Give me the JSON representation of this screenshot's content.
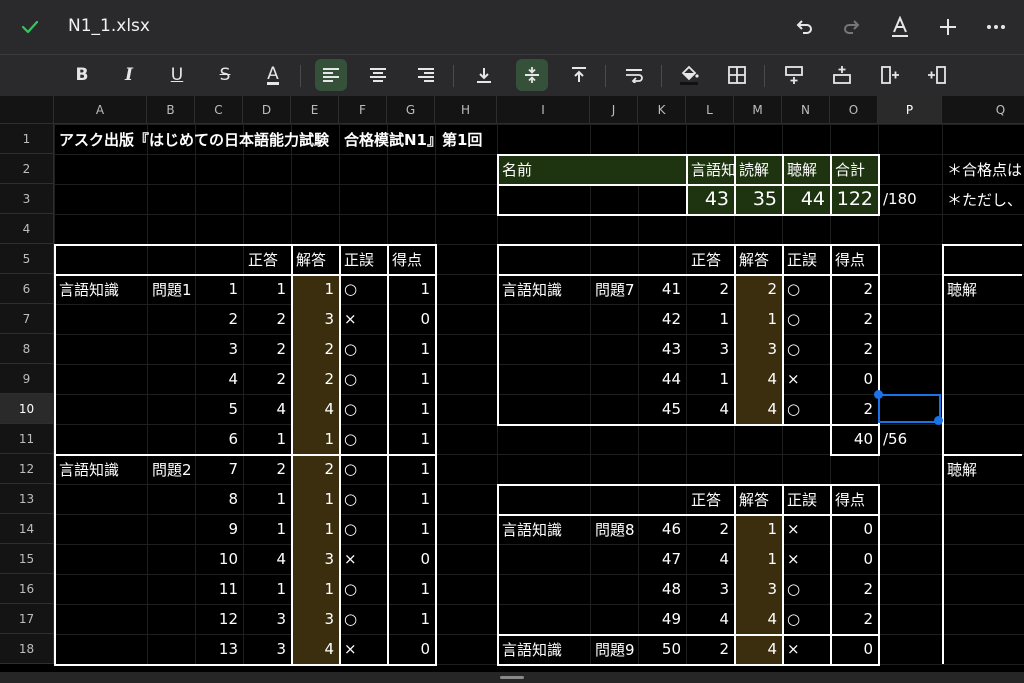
{
  "app": {
    "filename": "N1_1.xlsx",
    "icons": {
      "done": "checkmark-icon",
      "undo": "undo-icon",
      "redo": "redo-icon",
      "format": "text-format-icon",
      "add": "plus-icon",
      "more": "ellipsis-icon"
    }
  },
  "toolbar": {
    "buttons": [
      {
        "name": "bold-button",
        "glyph": "B"
      },
      {
        "name": "italic-button",
        "glyph": "I"
      },
      {
        "name": "underline-button",
        "glyph": "U"
      },
      {
        "name": "strikethrough-button",
        "glyph": "S"
      },
      {
        "name": "text-color-button",
        "glyph": "A"
      },
      {
        "name": "align-left-button",
        "glyph": "≡"
      },
      {
        "name": "align-center-button",
        "glyph": "≡"
      },
      {
        "name": "align-right-button",
        "glyph": "≡"
      },
      {
        "name": "valign-bottom-button",
        "glyph": "⤓"
      },
      {
        "name": "valign-middle-button",
        "glyph": "÷"
      },
      {
        "name": "valign-top-button",
        "glyph": "⤒"
      },
      {
        "name": "wrap-text-button",
        "glyph": "⇌"
      },
      {
        "name": "fill-color-button",
        "glyph": "◆"
      },
      {
        "name": "borders-button",
        "glyph": "⊞"
      },
      {
        "name": "insert-row-above-button",
        "glyph": "⊤"
      },
      {
        "name": "insert-row-below-button",
        "glyph": "⊥"
      },
      {
        "name": "insert-column-right-button",
        "glyph": "⊢"
      },
      {
        "name": "insert-column-left-button",
        "glyph": "⊣"
      }
    ]
  },
  "sheet": {
    "columns": [
      "A",
      "B",
      "C",
      "D",
      "E",
      "F",
      "G",
      "H",
      "I",
      "J",
      "K",
      "L",
      "M",
      "N",
      "O",
      "P",
      "Q"
    ],
    "rows": [
      "1",
      "2",
      "3",
      "4",
      "5",
      "6",
      "7",
      "8",
      "9",
      "10",
      "11",
      "12",
      "13",
      "14",
      "15",
      "16",
      "17",
      "18"
    ],
    "selected_column": "P",
    "selected_row": "10",
    "title": "アスク出版『はじめての日本語能力試験　合格模試N1』第1回",
    "summary": {
      "name_label": "名前",
      "headers": [
        "言語知識",
        "読解",
        "聴解",
        "合計"
      ],
      "values": [
        "43",
        "35",
        "44",
        "122"
      ],
      "max_total": "/180"
    },
    "notes": [
      "＊合格点は",
      "＊ただし、"
    ],
    "table_headers": [
      "正答",
      "解答",
      "正誤",
      "得点"
    ],
    "left_table": {
      "rows": [
        {
          "section": "言語知識",
          "problem": "問題1",
          "no": "1",
          "correct": "1",
          "answer": "1",
          "result": "○",
          "score": "1"
        },
        {
          "section": "",
          "problem": "",
          "no": "2",
          "correct": "2",
          "answer": "3",
          "result": "×",
          "score": "0"
        },
        {
          "section": "",
          "problem": "",
          "no": "3",
          "correct": "2",
          "answer": "2",
          "result": "○",
          "score": "1"
        },
        {
          "section": "",
          "problem": "",
          "no": "4",
          "correct": "2",
          "answer": "2",
          "result": "○",
          "score": "1"
        },
        {
          "section": "",
          "problem": "",
          "no": "5",
          "correct": "4",
          "answer": "4",
          "result": "○",
          "score": "1"
        },
        {
          "section": "",
          "problem": "",
          "no": "6",
          "correct": "1",
          "answer": "1",
          "result": "○",
          "score": "1"
        },
        {
          "section": "言語知識",
          "problem": "問題2",
          "no": "7",
          "correct": "2",
          "answer": "2",
          "result": "○",
          "score": "1"
        },
        {
          "section": "",
          "problem": "",
          "no": "8",
          "correct": "1",
          "answer": "1",
          "result": "○",
          "score": "1"
        },
        {
          "section": "",
          "problem": "",
          "no": "9",
          "correct": "1",
          "answer": "1",
          "result": "○",
          "score": "1"
        },
        {
          "section": "",
          "problem": "",
          "no": "10",
          "correct": "4",
          "answer": "3",
          "result": "×",
          "score": "0"
        },
        {
          "section": "",
          "problem": "",
          "no": "11",
          "correct": "1",
          "answer": "1",
          "result": "○",
          "score": "1"
        },
        {
          "section": "",
          "problem": "",
          "no": "12",
          "correct": "3",
          "answer": "3",
          "result": "○",
          "score": "1"
        },
        {
          "section": "",
          "problem": "",
          "no": "13",
          "correct": "3",
          "answer": "4",
          "result": "×",
          "score": "0"
        }
      ]
    },
    "mid_table_a": {
      "rows": [
        {
          "section": "言語知識",
          "problem": "問題7",
          "no": "41",
          "correct": "2",
          "answer": "2",
          "result": "○",
          "score": "2"
        },
        {
          "section": "",
          "problem": "",
          "no": "42",
          "correct": "1",
          "answer": "1",
          "result": "○",
          "score": "2"
        },
        {
          "section": "",
          "problem": "",
          "no": "43",
          "correct": "3",
          "answer": "3",
          "result": "○",
          "score": "2"
        },
        {
          "section": "",
          "problem": "",
          "no": "44",
          "correct": "1",
          "answer": "4",
          "result": "×",
          "score": "0"
        },
        {
          "section": "",
          "problem": "",
          "no": "45",
          "correct": "4",
          "answer": "4",
          "result": "○",
          "score": "2"
        }
      ],
      "subtotal": "40",
      "subtotal_max": "/56"
    },
    "mid_table_b": {
      "rows": [
        {
          "section": "言語知識",
          "problem": "問題8",
          "no": "46",
          "correct": "2",
          "answer": "1",
          "result": "×",
          "score": "0"
        },
        {
          "section": "",
          "problem": "",
          "no": "47",
          "correct": "4",
          "answer": "1",
          "result": "×",
          "score": "0"
        },
        {
          "section": "",
          "problem": "",
          "no": "48",
          "correct": "3",
          "answer": "3",
          "result": "○",
          "score": "2"
        },
        {
          "section": "",
          "problem": "",
          "no": "49",
          "correct": "4",
          "answer": "4",
          "result": "○",
          "score": "2"
        },
        {
          "section": "言語知識",
          "problem": "問題9",
          "no": "50",
          "correct": "2",
          "answer": "4",
          "result": "×",
          "score": "0"
        }
      ]
    },
    "right_labels": [
      "聴解",
      "聴解"
    ],
    "colors": {
      "answer_fill": "#3a2e0f",
      "header_fill": "#1e3310",
      "selection": "#1a73e8",
      "accent_green": "#34c759"
    }
  }
}
